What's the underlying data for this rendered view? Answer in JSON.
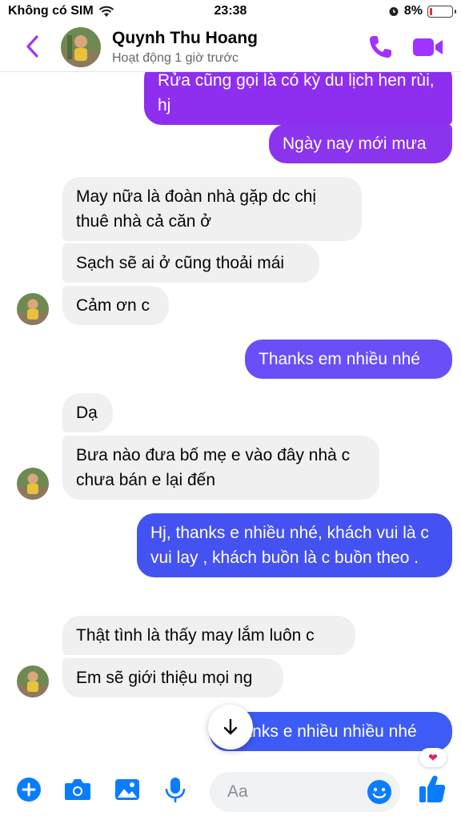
{
  "status_bar": {
    "carrier": "Không có SIM",
    "time": "23:38",
    "battery": "8%",
    "battery_level": 0.08
  },
  "header": {
    "name": "Quynh Thu Hoang",
    "status": "Hoạt động 1 giờ trước",
    "accent": "#a033ff"
  },
  "messages": {
    "m1": "Rửa cũng gọi là có kỳ du lịch hen rùi, hj",
    "m2": "Ngày nay mới mưa",
    "m3": "May nữa là đoàn nhà gặp dc chị thuê nhà cả căn ở",
    "m4": "Sạch sẽ ai ở cũng thoải mái",
    "m5": "Cảm ơn c",
    "m6": "Thanks em nhiều nhé",
    "m7": "Dạ",
    "m8": "Bưa nào đưa bố mẹ e vào đây nhà c chưa bán e lại đến",
    "m9": "Hj, thanks e nhiều nhé, khách vui là c vui lay , khách buồn là c buồn theo .",
    "m10": "Thật tình là thấy may lắm luôn c",
    "m11": "Em sẽ giới thiệu mọi ng",
    "m12": "Thanks e nhiều nhiều nhé"
  },
  "reaction": "heart",
  "composer": {
    "placeholder": "Aa"
  },
  "colors": {
    "outgoing_purple": "#8e2ff0",
    "outgoing_violet": "#6a4ef8",
    "outgoing_blue": "#4452f2",
    "incoming": "#f0f0f0",
    "icon_blue": "#0a7cff"
  }
}
